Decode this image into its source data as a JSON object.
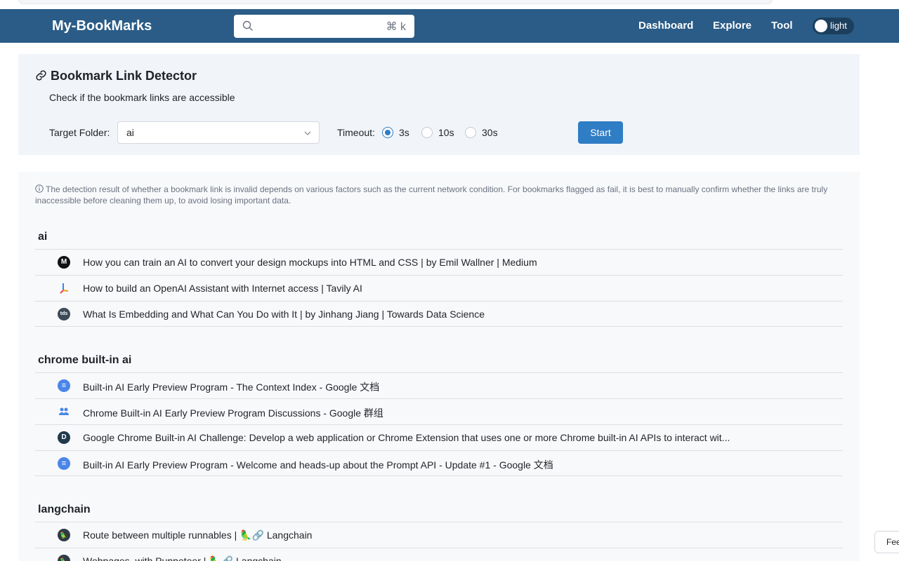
{
  "navbar": {
    "brand": "My-BookMarks",
    "search_shortcut": "⌘ k",
    "links": [
      "Dashboard",
      "Explore",
      "Tool"
    ],
    "theme_label": "light"
  },
  "detector": {
    "title": "Bookmark Link Detector",
    "description": "Check if the bookmark links are accessible",
    "target_folder_label": "Target Folder:",
    "target_folder_value": "ai",
    "timeout_label": "Timeout:",
    "timeouts": [
      "3s",
      "10s",
      "30s"
    ],
    "selected_timeout": "3s",
    "start_label": "Start"
  },
  "notice": "The detection result of whether a bookmark link is invalid depends on various factors such as the current network condition. For bookmarks flagged as fail, it is best to manually confirm whether the links are truly inaccessible before cleaning them up, to avoid losing important data.",
  "groups": [
    {
      "name": "ai",
      "items": [
        {
          "title": "How you can train an AI to convert your design mockups into HTML and CSS | by Emil Wallner | Medium",
          "icon": "medium-icon"
        },
        {
          "title": "How to build an OpenAI Assistant with Internet access | Tavily AI",
          "icon": "tavily-icon"
        },
        {
          "title": "What Is Embedding and What Can You Do with It | by Jinhang Jiang | Towards Data Science",
          "icon": "tds-icon"
        }
      ]
    },
    {
      "name": "chrome built-in ai",
      "items": [
        {
          "title": "Built-in AI Early Preview Program - The Context Index - Google 文档",
          "icon": "google-docs-icon"
        },
        {
          "title": "Chrome Built-in AI Early Preview Program Discussions - Google 群组",
          "icon": "google-groups-icon"
        },
        {
          "title": "Google Chrome Built-in AI Challenge: Develop a web application or Chrome Extension that uses one or more Chrome built-in AI APIs to interact wit...",
          "icon": "devpost-icon"
        },
        {
          "title": "Built-in AI Early Preview Program - Welcome and heads-up about the Prompt API - Update #1 - Google 文档",
          "icon": "google-docs-icon"
        }
      ]
    },
    {
      "name": "langchain",
      "items": [
        {
          "title": "Route between multiple runnables | 🦜🔗 Langchain",
          "icon": "langchain-icon"
        },
        {
          "title": "Webpages, with Puppeteer | 🦜🔗 Langchain",
          "icon": "langchain-icon"
        }
      ]
    }
  ],
  "feedback_label": "Feedback",
  "colors": {
    "navbar": "#2a5c87",
    "accent": "#2f7dc4",
    "panel": "#f1f4f8"
  }
}
